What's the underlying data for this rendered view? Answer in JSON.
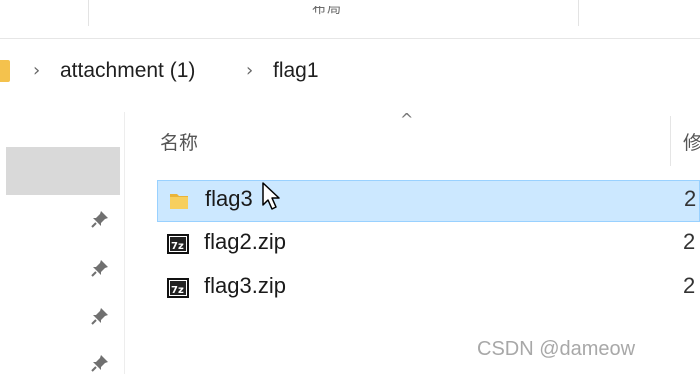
{
  "ribbon": {
    "partial_label": "布局"
  },
  "breadcrumb": {
    "items": [
      "attachment (1)",
      "flag1"
    ]
  },
  "file_list": {
    "name_column_header": "名称",
    "second_column_header_partial": "修",
    "rows": [
      {
        "name": "flag3",
        "type": "folder",
        "date_partial": "2",
        "selected": true
      },
      {
        "name": "flag2.zip",
        "type": "7z-archive",
        "date_partial": "2",
        "selected": false
      },
      {
        "name": "flag3.zip",
        "type": "7z-archive",
        "date_partial": "2",
        "selected": false
      }
    ]
  },
  "nav_pane": {
    "pin_icons": 4
  },
  "watermark": "CSDN @dameow",
  "colors": {
    "selection_bg": "#cce8ff",
    "selection_border": "#99d1ff",
    "folder": "#f4c24d"
  }
}
